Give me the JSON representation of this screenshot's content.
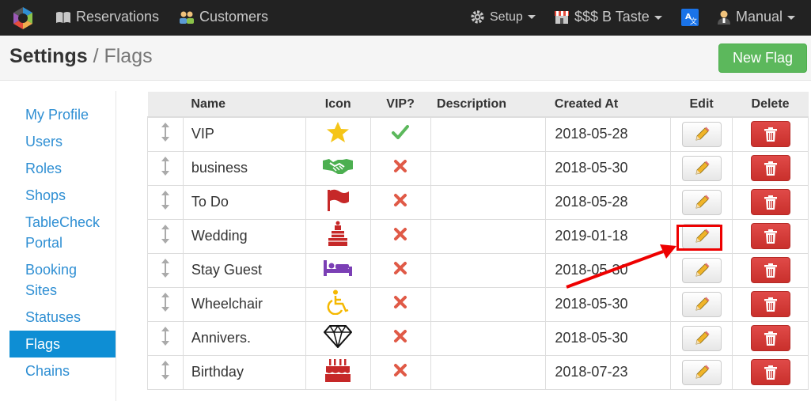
{
  "navbar": {
    "reservations": "Reservations",
    "customers": "Customers",
    "setup": "Setup",
    "shop": "$$$ B Taste",
    "user": "Manual",
    "icons": {
      "reservations": "book-icon",
      "customers": "users-icon",
      "setup": "gear-icon",
      "shop": "store-icon",
      "translate": "translate-icon",
      "user": "user-icon"
    }
  },
  "header": {
    "title": "Settings",
    "separator": " / ",
    "subtitle": "Flags",
    "new_flag": "New Flag"
  },
  "sidebar": {
    "items": [
      {
        "label": "My Profile"
      },
      {
        "label": "Users"
      },
      {
        "label": "Roles"
      },
      {
        "label": "Shops"
      },
      {
        "label": "TableCheck Portal"
      },
      {
        "label": "Booking Sites"
      },
      {
        "label": "Statuses"
      },
      {
        "label": "Flags",
        "active": true
      },
      {
        "label": "Chains"
      }
    ]
  },
  "table": {
    "headers": {
      "name": "Name",
      "icon": "Icon",
      "vip": "VIP?",
      "description": "Description",
      "created": "Created At",
      "edit": "Edit",
      "delete": "Delete"
    },
    "rows": [
      {
        "name": "VIP",
        "icon": "star-icon",
        "vip": true,
        "description": "",
        "created": "2018-05-28"
      },
      {
        "name": "business",
        "icon": "handshake-icon",
        "vip": false,
        "description": "",
        "created": "2018-05-30"
      },
      {
        "name": "To Do",
        "icon": "flag-icon",
        "vip": false,
        "description": "",
        "created": "2018-05-28"
      },
      {
        "name": "Wedding",
        "icon": "wedding-cake-icon",
        "vip": false,
        "description": "",
        "created": "2019-01-18"
      },
      {
        "name": "Stay Guest",
        "icon": "bed-icon",
        "vip": false,
        "description": "",
        "created": "2018-05-30"
      },
      {
        "name": "Wheelchair",
        "icon": "wheelchair-icon",
        "vip": false,
        "description": "",
        "created": "2018-05-30"
      },
      {
        "name": "Annivers.",
        "icon": "diamond-icon",
        "vip": false,
        "description": "",
        "created": "2018-05-30"
      },
      {
        "name": "Birthday",
        "icon": "birthday-cake-icon",
        "vip": false,
        "description": "",
        "created": "2018-07-23"
      }
    ]
  },
  "colors": {
    "navbar_bg": "#222222",
    "accent": "#0e8ed4",
    "link": "#2f8fd3",
    "success": "#5cb85c",
    "danger": "#d9534f",
    "annotation": "#ee0000"
  }
}
